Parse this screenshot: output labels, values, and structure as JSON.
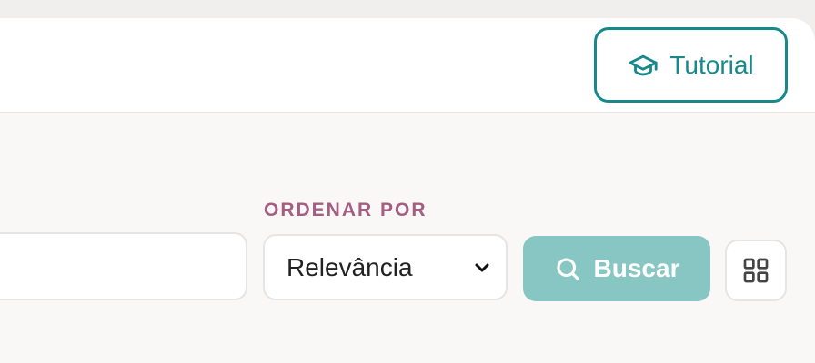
{
  "header": {
    "tutorial_label": "Tutorial",
    "tutorial_icon": "graduation-cap-icon"
  },
  "filters": {
    "sort_label": "ORDENAR POR",
    "sort_value": "Relevância",
    "search_value": "",
    "search_button_label": "Buscar",
    "search_icon": "search-icon",
    "view_toggle_icon": "grid-view-icon"
  },
  "colors": {
    "accent": "#17898a",
    "accent_light": "#88c6c3",
    "label_color": "#a45e82",
    "card_background": "#faf8f6"
  }
}
